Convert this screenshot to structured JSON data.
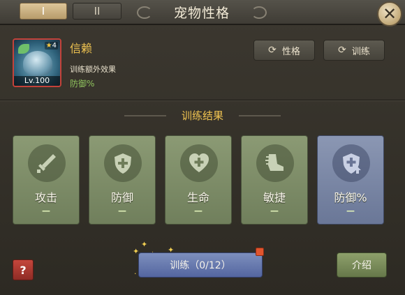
{
  "tabs": [
    {
      "label": "I",
      "active": true
    },
    {
      "label": "II",
      "active": false
    }
  ],
  "window": {
    "title": "宠物性格",
    "close_icon": "close-icon"
  },
  "pet": {
    "name": "信赖",
    "stars": "4",
    "level": "Lv.100",
    "effect_title": "训练额外效果",
    "effect_value": "防御%"
  },
  "buttons": {
    "personality": "性格",
    "training": "训练",
    "train_action": "训练（0/12）",
    "intro": "介绍",
    "help": "?"
  },
  "section": {
    "title": "训练结果"
  },
  "stats": [
    {
      "label": "攻击",
      "value": "—",
      "icon": "sword-icon",
      "highlight": false
    },
    {
      "label": "防御",
      "value": "—",
      "icon": "shield-cross-icon",
      "highlight": false
    },
    {
      "label": "生命",
      "value": "—",
      "icon": "heart-plus-icon",
      "highlight": false
    },
    {
      "label": "敏捷",
      "value": "—",
      "icon": "boot-icon",
      "highlight": false
    },
    {
      "label": "防御%",
      "value": "—",
      "icon": "shield-up-icon",
      "highlight": true
    }
  ],
  "colors": {
    "accent_gold": "#f0c451",
    "effect_green": "#8fc25d",
    "card_green": "#7d8c66",
    "card_blue": "#7a86a5",
    "train_button_blue": "#6677ad"
  }
}
